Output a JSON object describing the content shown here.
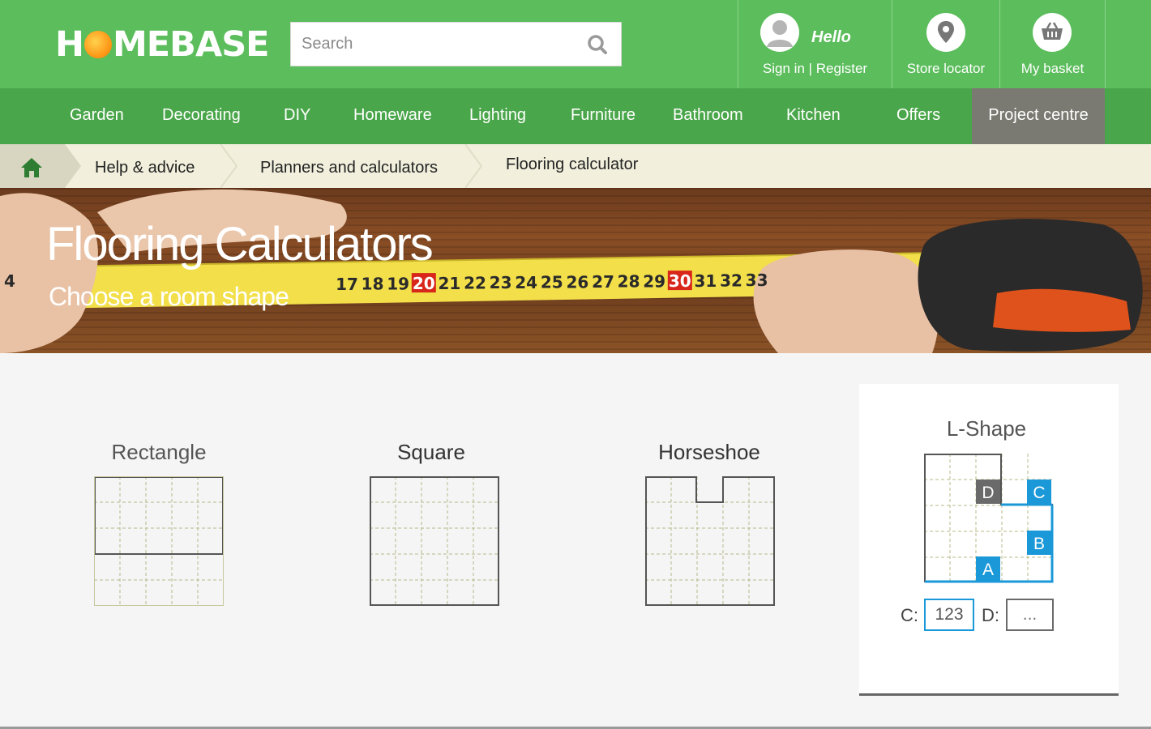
{
  "header": {
    "logo_left": "H",
    "logo_right": "MEBASE",
    "search_placeholder": "Search",
    "account": {
      "greeting": "Hello",
      "label": "Sign in | Register",
      "icon": "user-icon"
    },
    "store": {
      "label": "Store locator",
      "icon": "map-pin-icon"
    },
    "basket": {
      "label": "My basket",
      "icon": "basket-icon"
    }
  },
  "nav": {
    "items": [
      "Garden",
      "Decorating",
      "DIY",
      "Homeware",
      "Lighting",
      "Furniture",
      "Bathroom",
      "Kitchen",
      "Offers",
      "Project centre"
    ],
    "active": "Project centre"
  },
  "breadcrumb": {
    "home_icon": "home-icon",
    "items": [
      "Help & advice",
      "Planners and calculators",
      "Flooring calculator"
    ]
  },
  "hero": {
    "title": "Flooring Calculators",
    "subtitle": "Choose a room shape",
    "tape_numbers": [
      "4",
      "17",
      "18",
      "19",
      "20",
      "21",
      "22",
      "23",
      "24",
      "25",
      "26",
      "27",
      "28",
      "29",
      "30",
      "31",
      "32",
      "33"
    ]
  },
  "shapes": [
    {
      "name": "Rectangle"
    },
    {
      "name": "Square"
    },
    {
      "name": "Horseshoe"
    },
    {
      "name": "L-Shape",
      "selected": true,
      "markers": [
        "A",
        "B",
        "C",
        "D"
      ]
    }
  ],
  "l_shape_inputs": {
    "c_label": "C:",
    "c_value": "123",
    "d_label": "D:",
    "d_placeholder": "..."
  },
  "colors": {
    "header_green": "#5bbd5b",
    "nav_green": "#4aa64a",
    "active_nav": "#7a7a72",
    "highlight_blue": "#1a98d8",
    "marker_gray": "#6a6a6a"
  }
}
